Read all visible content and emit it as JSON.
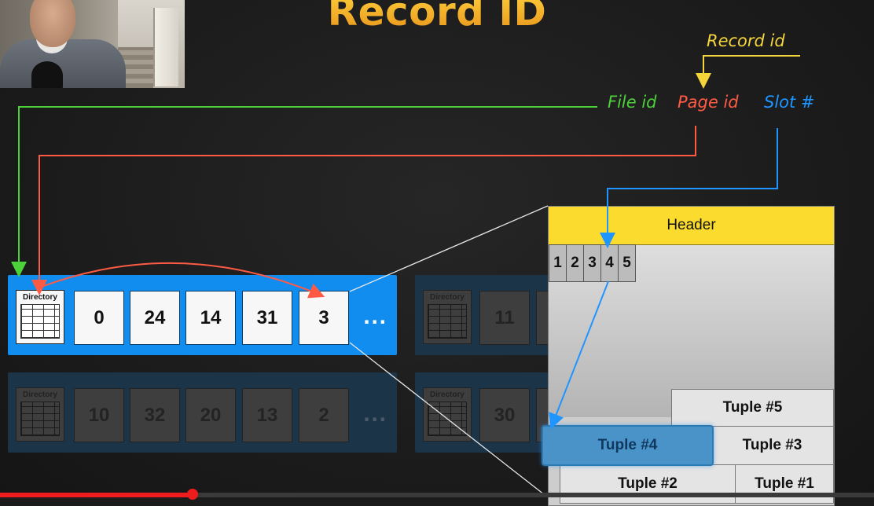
{
  "title": "Record ID",
  "labels": {
    "record_id": "Record id",
    "file_id": "File id",
    "page_id": "Page id",
    "slot": "Slot #"
  },
  "colors": {
    "file_id": "#4cd13a",
    "page_id": "#ff5a44",
    "slot": "#1f95ff",
    "record_id": "#f3d43a",
    "active_row": "#118df0",
    "header": "#fbdc2e"
  },
  "directory_rows": [
    {
      "directory_label": "Directory",
      "pages": [
        "0",
        "24",
        "14",
        "31",
        "3"
      ],
      "ellipsis": "...",
      "active": true
    },
    {
      "directory_label": "Directory",
      "pages": [
        "11"
      ],
      "active": false
    },
    {
      "directory_label": "Directory",
      "pages": [
        "10",
        "32",
        "20",
        "13",
        "2"
      ],
      "ellipsis": "...",
      "active": false
    },
    {
      "directory_label": "Directory",
      "pages": [
        "30"
      ],
      "active": false
    }
  ],
  "page_detail": {
    "header": "Header",
    "slots": [
      "1",
      "2",
      "3",
      "4",
      "5"
    ],
    "tuples": {
      "t5": "Tuple #5",
      "t4": "Tuple #4",
      "t3": "Tuple #3",
      "t2": "Tuple #2",
      "t1": "Tuple #1"
    },
    "highlighted_tuple": "Tuple #4"
  },
  "video_progress": 0.22
}
